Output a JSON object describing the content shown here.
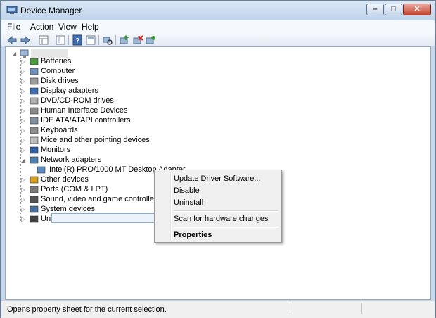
{
  "window": {
    "title": "Device Manager",
    "caption_buttons": {
      "minimize": "minimize",
      "maximize": "maximize",
      "close": "close"
    }
  },
  "menubar": {
    "items": [
      {
        "label": "File"
      },
      {
        "label": "Action"
      },
      {
        "label": "View"
      },
      {
        "label": "Help"
      }
    ]
  },
  "toolbar": {
    "buttons": [
      "back-icon",
      "forward-icon",
      "properties-grid-icon",
      "show-hide-tree-icon",
      "help-icon",
      "view-icon",
      "scan-hardware-icon",
      "update-driver-icon",
      "uninstall-icon",
      "enable-device-icon"
    ]
  },
  "tree": {
    "root_label": "",
    "items": [
      {
        "label": "Batteries",
        "icon": "battery-icon"
      },
      {
        "label": "Computer",
        "icon": "computer-icon"
      },
      {
        "label": "Disk drives",
        "icon": "disk-drive-icon"
      },
      {
        "label": "Display adapters",
        "icon": "display-adapter-icon"
      },
      {
        "label": "DVD/CD-ROM drives",
        "icon": "dvd-drive-icon"
      },
      {
        "label": "Human Interface Devices",
        "icon": "hid-icon"
      },
      {
        "label": "IDE ATA/ATAPI controllers",
        "icon": "ide-controller-icon"
      },
      {
        "label": "Keyboards",
        "icon": "keyboard-icon"
      },
      {
        "label": "Mice and other pointing devices",
        "icon": "mouse-icon"
      },
      {
        "label": "Monitors",
        "icon": "monitor-icon"
      },
      {
        "label": "Network adapters",
        "icon": "network-adapter-icon"
      },
      {
        "label": "Intel(R) PRO/1000 MT Desktop Adapter",
        "icon": "network-card-icon"
      },
      {
        "label": "Other devices",
        "icon": "other-devices-icon"
      },
      {
        "label": "Ports (COM & LPT)",
        "icon": "port-icon"
      },
      {
        "label": "Sound, video and game controllers",
        "icon": "sound-icon"
      },
      {
        "label": "System devices",
        "icon": "system-devices-icon"
      },
      {
        "label": "Universal Serial Bus controllers",
        "icon": "usb-icon"
      }
    ]
  },
  "context_menu": {
    "update_driver": "Update Driver Software...",
    "disable": "Disable",
    "uninstall": "Uninstall",
    "scan": "Scan for hardware changes",
    "properties": "Properties"
  },
  "statusbar": {
    "text": "Opens property sheet for the current selection."
  }
}
